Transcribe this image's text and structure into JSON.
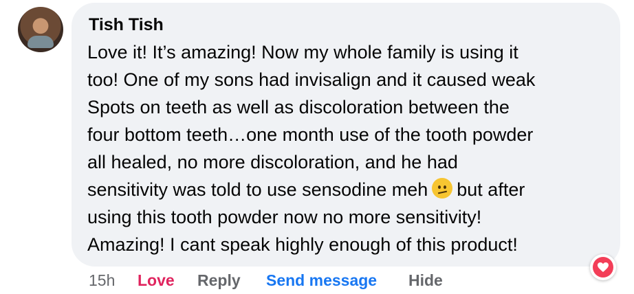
{
  "comment": {
    "author": "Tish Tish",
    "text_before_emoji": "Love it! It’s amazing! Now my whole family is using it\ntoo! One of my sons had invisalign and it caused weak\nSpots on teeth as well as discoloration between the\nfour bottom teeth…one month use of the tooth powder\nall healed, no more discoloration, and he had\nsensitivity was told to use sensodine meh",
    "emoji_icon": "confused-face-emoji",
    "text_after_emoji": "but after\nusing this tooth powder now no more sensitivity!\nAmazing! I cant speak highly enough of this product!"
  },
  "actions": {
    "time": "15h",
    "love": "Love",
    "reply": "Reply",
    "send_message": "Send message",
    "hide": "Hide"
  },
  "reaction": {
    "icon": "heart-icon",
    "color": "#f33e58"
  },
  "colors": {
    "bubble": "#f0f2f5",
    "love_active": "#e0245e",
    "send_message": "#1877f2",
    "muted": "#65676b"
  }
}
